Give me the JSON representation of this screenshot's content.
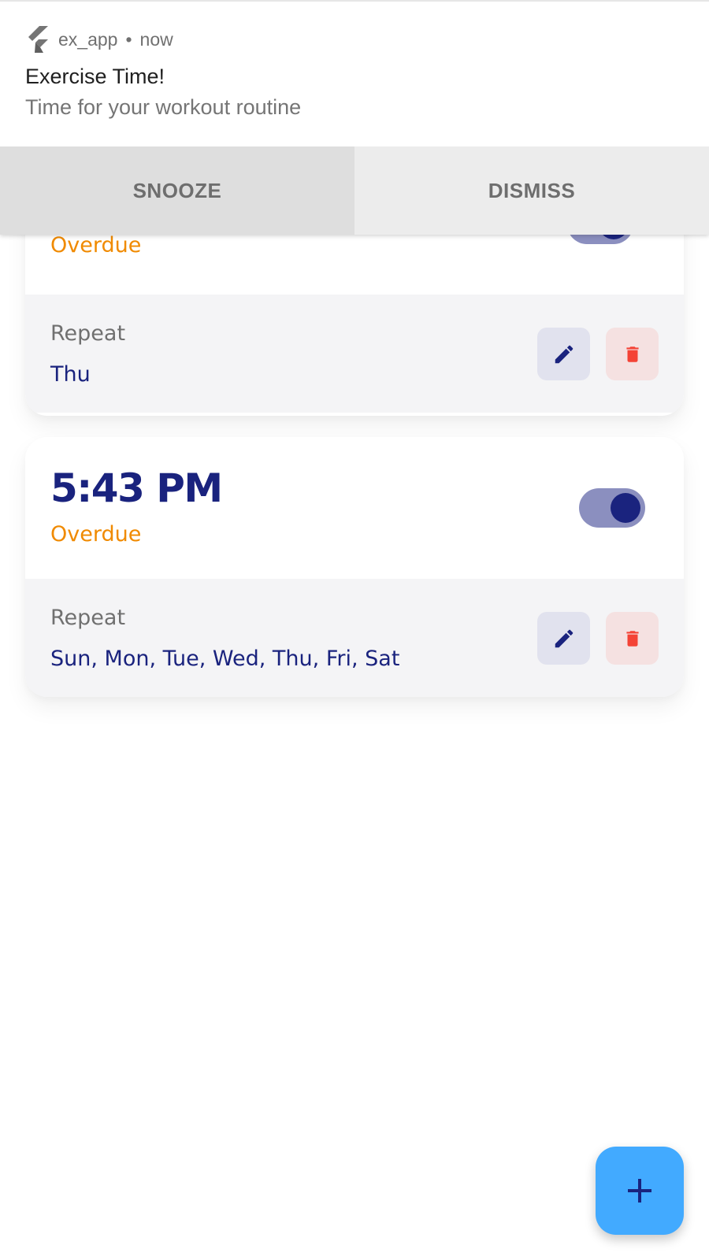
{
  "notification": {
    "app_name": "ex_app",
    "separator": "•",
    "time": "now",
    "title": "Exercise Time!",
    "body": "Time for your workout routine",
    "actions": {
      "snooze_label": "SNOOZE",
      "dismiss_label": "DISMISS"
    },
    "app_icon": "flutter-logo-icon"
  },
  "alarms": [
    {
      "status": "Overdue",
      "repeat_label": "Repeat",
      "repeat_days": "Thu",
      "enabled": true
    },
    {
      "time": "5:43 PM",
      "status": "Overdue",
      "repeat_label": "Repeat",
      "repeat_days": "Sun, Mon, Tue, Wed, Thu, Fri, Sat",
      "enabled": true
    }
  ],
  "icons": {
    "edit": "pencil-icon",
    "delete": "trash-icon",
    "add": "plus-icon"
  },
  "colors": {
    "primary": "#1a237e",
    "overdue": "#f08a00",
    "toggle_track": "#8b8fbf",
    "delete": "#f44336",
    "fab": "#42aaff",
    "repeat_panel": "#f4f4f6"
  }
}
